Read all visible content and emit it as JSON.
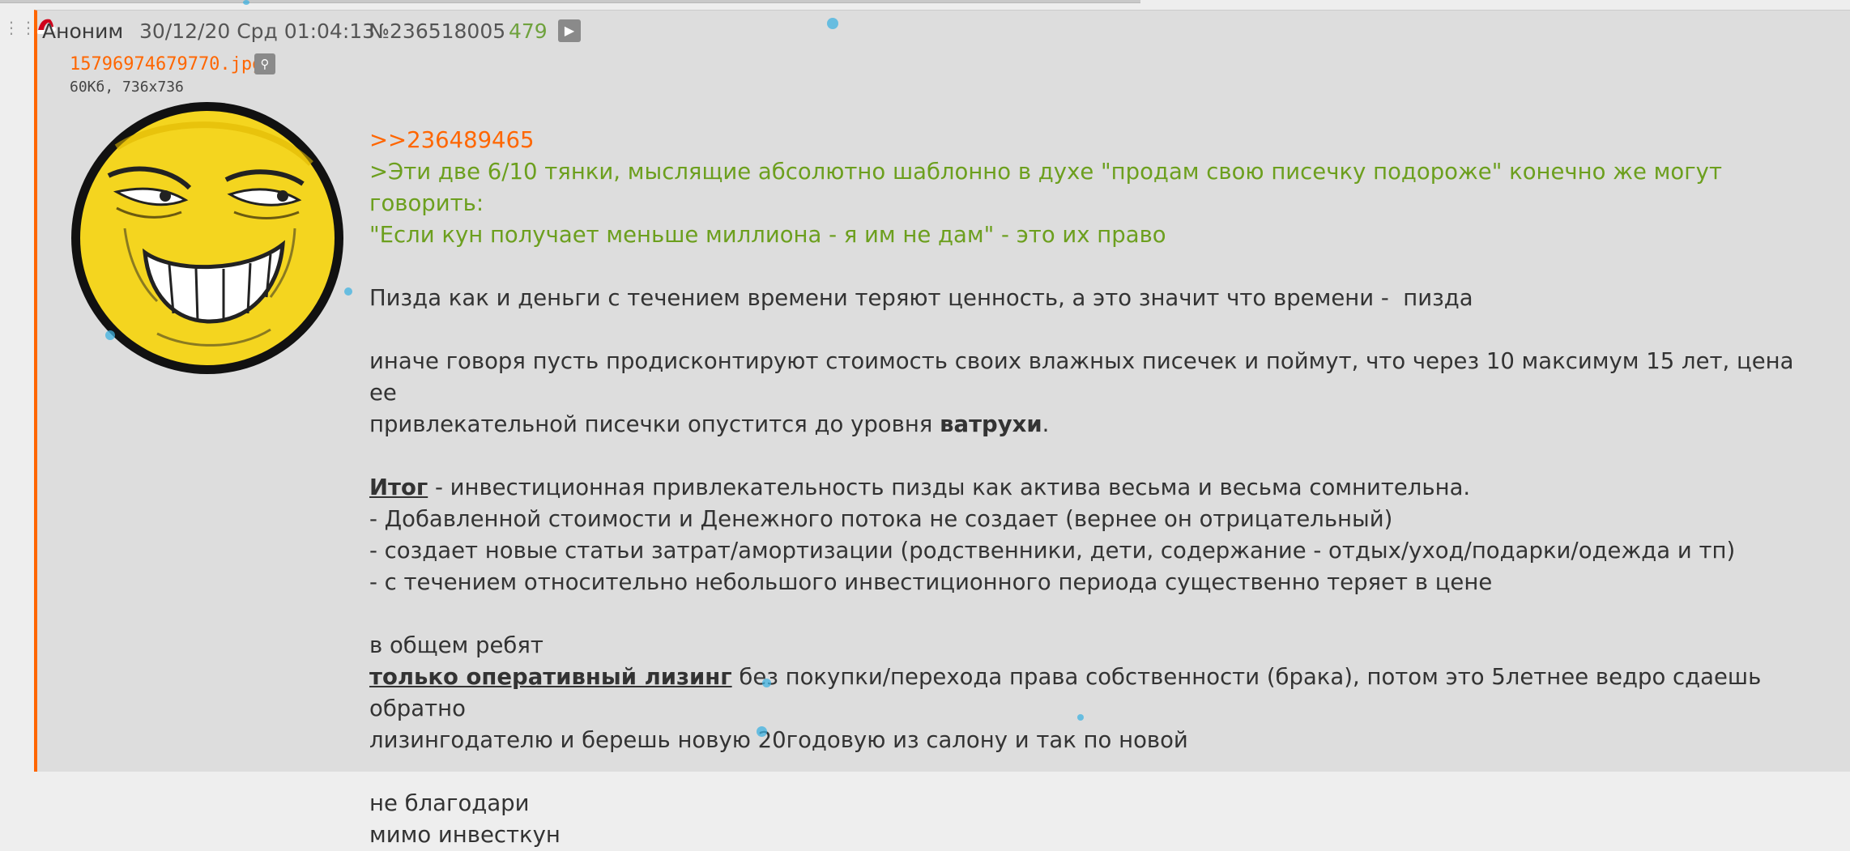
{
  "post": {
    "author": "Аноним",
    "date": "30/12/20 Срд 01:04:13",
    "number": "№236518005",
    "counter": "479",
    "file": {
      "name": "15796974679770.jpg",
      "info": "60Кб, 736x736"
    },
    "reply_link": ">>236489465",
    "quote_line_1": ">Эти две 6/10 тянки, мыслящие абсолютно шаблонно в духе \"продам свою писечку подороже\" конечно же могут говорить:",
    "quote_line_2": "\"Если кун получает меньше миллиона - я им не дам\" - это их право",
    "para_1": "Пизда как и деньги с течением времени теряют ценность, а это значит что времени -  пизда",
    "para_2_line_1": "иначе говоря пусть продисконтируют стоимость своих влажных писечек и поймут, что через 10 максимум 15 лет, цена ее",
    "para_2_line_2_a": "привлекательной писечки опустится до уровня ",
    "para_2_line_2_bold": "ватрухи",
    "para_2_line_2_end": ".",
    "summary_title": "Итог",
    "summary_text": " - инвестиционная привлекательность пизды как актива весьма и весьма сомнительна.",
    "bullet_1": "- Добавленной стоимости и Денежного потока не создает (вернее он отрицательный)",
    "bullet_2": "- создает новые статьи затрат/амортизации (родственники, дети, содержание - отдых/уход/подарки/одежда и тп)",
    "bullet_3": "- с течением относительно небольшого инвестиционного периода существенно теряет в цене",
    "para_3_line_1": "в общем ребят",
    "para_3_bold": "только оперативный лизинг",
    "para_3_line_2": " без покупки/перехода права собственности (брака), потом это 5летнее ведро сдаешь обратно",
    "para_3_line_3": "лизингодателю и берешь новую 20годовую из салону и так по новой",
    "closing_1": "не благодари",
    "closing_2": "мимо инвесткун"
  },
  "colors": {
    "accent": "#ff6600",
    "quote": "#6c9f1e",
    "counter": "#6fa23d",
    "post_bg": "#dddddd",
    "page_bg": "#eeeeee"
  }
}
